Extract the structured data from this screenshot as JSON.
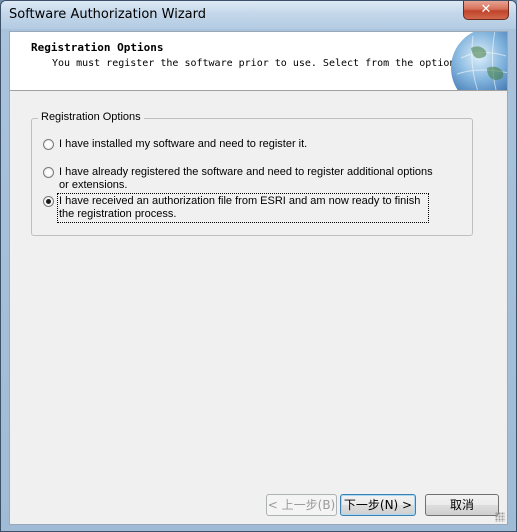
{
  "window": {
    "title": "Software Authorization Wizard",
    "close_label": "✕"
  },
  "header": {
    "title": "Registration Options",
    "subtitle": "You must register the software prior to use. Select from the options below."
  },
  "options": {
    "group_label": "Registration Options",
    "items": [
      {
        "label": "I have installed my software and need to register it.",
        "selected": false
      },
      {
        "label": "I have already registered the software and need to register additional options or extensions.",
        "selected": false
      },
      {
        "label": "I have received an authorization file from ESRI and am now ready to finish the registration process.",
        "selected": true
      }
    ]
  },
  "buttons": {
    "back": "< 上一步(B)",
    "next": "下一步(N) >",
    "cancel": "取消"
  },
  "colors": {
    "accent": "#3c7fb1",
    "close": "#c0442a"
  }
}
